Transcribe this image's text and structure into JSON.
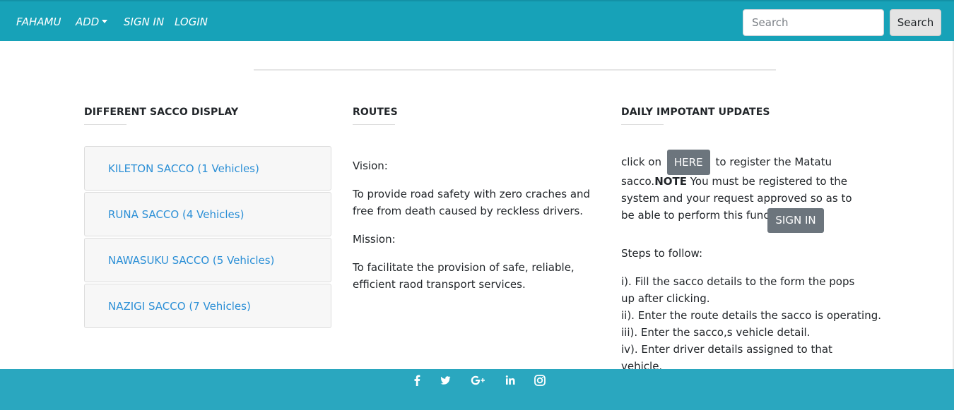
{
  "nav": {
    "brand": "FAHAMU",
    "add": "ADD",
    "sign_in": "SIGN IN",
    "login": "LOGIN",
    "search_placeholder": "Search",
    "search_button": "Search"
  },
  "sacco_section": {
    "title": "DIFFERENT SACCO DISPLAY",
    "items": [
      {
        "label": "KILETON SACCO (1 Vehicles)"
      },
      {
        "label": "RUNA SACCO (4 Vehicles)"
      },
      {
        "label": "NAWASUKU SACCO (5 Vehicles)"
      },
      {
        "label": "NAZIGI SACCO (7 Vehicles)"
      }
    ]
  },
  "routes": {
    "title": "ROUTES",
    "vision_label": "Vision:",
    "vision_text": "To provide road safety with zero craches and free from death caused by reckless drivers.",
    "mission_label": "Mission:",
    "mission_text": "To facilitate the provision of safe, reliable, efficient raod transport services."
  },
  "updates": {
    "title": "DAILY IMPOTANT UPDATES",
    "click_on": "click on",
    "here_button": "HERE",
    "register_text": "to register the Matatu",
    "sacco_text": "sacco.",
    "note_label": "NOTE",
    "note_text": " You must be registered to the system and your request approved so as to be able to perform this function.",
    "sign_in_button": "SIGN IN",
    "steps_label": "Steps to follow:",
    "steps": [
      "i). Fill the sacco details to the form the pops up after clicking.",
      "ii). Enter the route details the sacco is operating.",
      "iii). Enter the sacco,s vehicle detail.",
      "iv). Enter driver details assigned to that vehicle."
    ]
  },
  "footer": {
    "icons": [
      "facebook-icon",
      "twitter-icon",
      "google-plus-icon",
      "linkedin-icon",
      "instagram-icon"
    ]
  },
  "colors": {
    "navbar": "#17a2b8",
    "footer": "#2aa7bf",
    "link": "#2b8fd6",
    "gray_button": "#6c757d"
  }
}
